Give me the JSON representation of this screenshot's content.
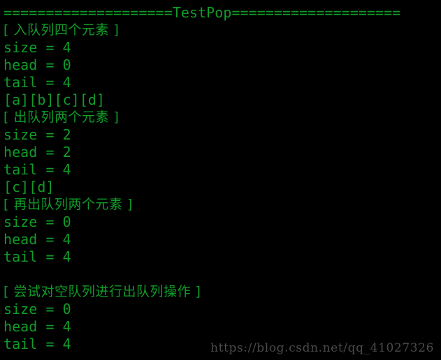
{
  "terminal": {
    "background_color": "#000000",
    "text_color": "#109c28",
    "header": "====================TestPop====================",
    "lines": [
      "====================TestPop====================",
      "[ 入队列四个元素 ]",
      "size = 4",
      "head = 0",
      "tail = 4",
      "[a][b][c][d]",
      "[ 出队列两个元素 ]",
      "size = 2",
      "head = 2",
      "tail = 4",
      "[c][d]",
      "[ 再出队列两个元素 ]",
      "size = 0",
      "head = 4",
      "tail = 4",
      "",
      "[ 尝试对空队列进行出队列操作 ]",
      "size = 0",
      "head = 4",
      "tail = 4"
    ],
    "blocks": [
      {
        "label": "[ 入队列四个元素 ]",
        "size": "size = 4",
        "head": "head = 0",
        "tail": "tail = 4",
        "contents": "[a][b][c][d]"
      },
      {
        "label": "[ 出队列两个元素 ]",
        "size": "size = 2",
        "head": "head = 2",
        "tail": "tail = 4",
        "contents": "[c][d]"
      },
      {
        "label": "[ 再出队列两个元素 ]",
        "size": "size = 0",
        "head": "head = 4",
        "tail": "tail = 4",
        "contents": ""
      },
      {
        "label": "[ 尝试对空队列进行出队列操作 ]",
        "size": "size = 0",
        "head": "head = 4",
        "tail": "tail = 4",
        "contents": ""
      }
    ]
  },
  "watermark": {
    "text": "https://blog.csdn.net/qq_41027326",
    "color": "#4b4b4b"
  }
}
